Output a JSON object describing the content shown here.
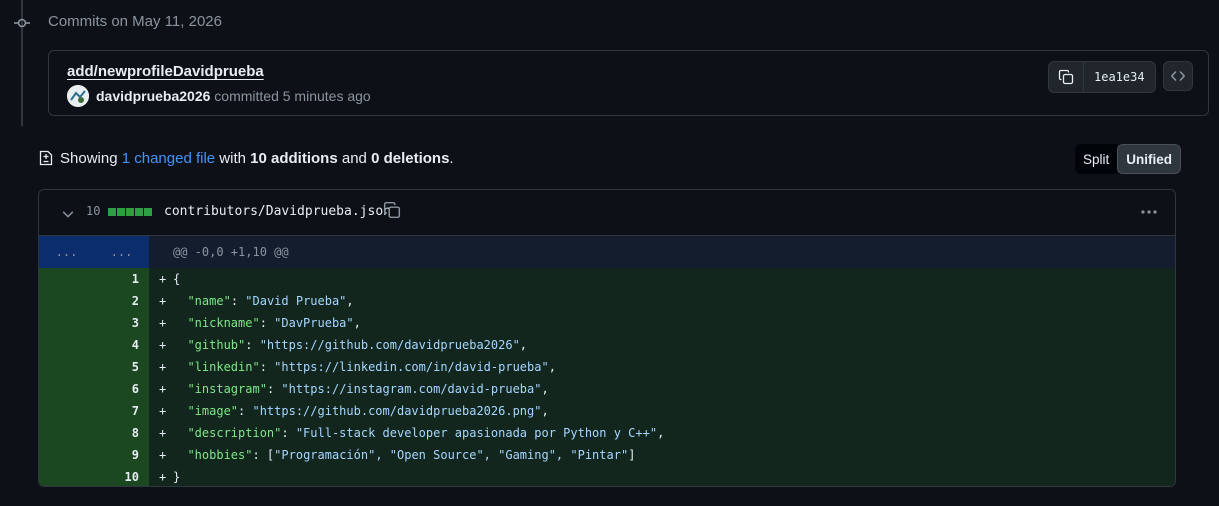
{
  "timeline": {
    "heading": "Commits on May 11, 2026"
  },
  "commit": {
    "title": "add/newprofileDavidprueba",
    "author": "davidprueba2026",
    "action": "committed",
    "time": "5 minutes ago",
    "sha": "1ea1e34"
  },
  "summary": {
    "showing": "Showing",
    "changed_files": "1 changed file",
    "with": "with",
    "additions": "10 additions",
    "and": "and",
    "deletions": "0 deletions",
    "period": "."
  },
  "view_toggle": {
    "split": "Split",
    "unified": "Unified",
    "selected": "Unified"
  },
  "file": {
    "change_count": "10",
    "path": "contributors/Davidprueba.json",
    "hunk_gutter_old": "...",
    "hunk_gutter_new": "...",
    "hunk_header": "@@ -0,0 +1,10 @@",
    "lines": [
      {
        "num": "1",
        "marker": "+",
        "indent": "",
        "key": "",
        "sep": "",
        "value": "",
        "tail": "{"
      },
      {
        "num": "2",
        "marker": "+",
        "indent": "  ",
        "key": "\"name\"",
        "sep": ": ",
        "value": "\"David Prueba\"",
        "tail": ","
      },
      {
        "num": "3",
        "marker": "+",
        "indent": "  ",
        "key": "\"nickname\"",
        "sep": ": ",
        "value": "\"DavPrueba\"",
        "tail": ","
      },
      {
        "num": "4",
        "marker": "+",
        "indent": "  ",
        "key": "\"github\"",
        "sep": ": ",
        "value": "\"https://github.com/davidprueba2026\"",
        "tail": ","
      },
      {
        "num": "5",
        "marker": "+",
        "indent": "  ",
        "key": "\"linkedin\"",
        "sep": ": ",
        "value": "\"https://linkedin.com/in/david-prueba\"",
        "tail": ","
      },
      {
        "num": "6",
        "marker": "+",
        "indent": "  ",
        "key": "\"instagram\"",
        "sep": ": ",
        "value": "\"https://instagram.com/david-prueba\"",
        "tail": ","
      },
      {
        "num": "7",
        "marker": "+",
        "indent": "  ",
        "key": "\"image\"",
        "sep": ": ",
        "value": "\"https://github.com/davidprueba2026.png\"",
        "tail": ","
      },
      {
        "num": "8",
        "marker": "+",
        "indent": "  ",
        "key": "\"description\"",
        "sep": ": ",
        "value": "\"Full-stack developer apasionada por Python y C++\"",
        "tail": ","
      },
      {
        "num": "9",
        "marker": "+",
        "indent": "  ",
        "key": "\"hobbies\"",
        "sep": ": [",
        "value": "\"Programación\", \"Open Source\", \"Gaming\", \"Pintar\"",
        "tail": "]"
      },
      {
        "num": "10",
        "marker": "+",
        "indent": "",
        "key": "",
        "sep": "",
        "value": "",
        "tail": "}"
      }
    ]
  },
  "colors": {
    "background": "#0d1117",
    "addition_line_bg": "#12261e",
    "addition_gutter_bg": "#1b4721",
    "hunk_gutter_bg": "#0c2d6b",
    "link": "#4493f8",
    "diffstat_green": "#2ea043"
  },
  "icons": [
    "git-commit-icon",
    "copy-icon",
    "code-icon",
    "file-diff-icon",
    "chevron-down-icon",
    "kebab-horizontal-icon"
  ]
}
